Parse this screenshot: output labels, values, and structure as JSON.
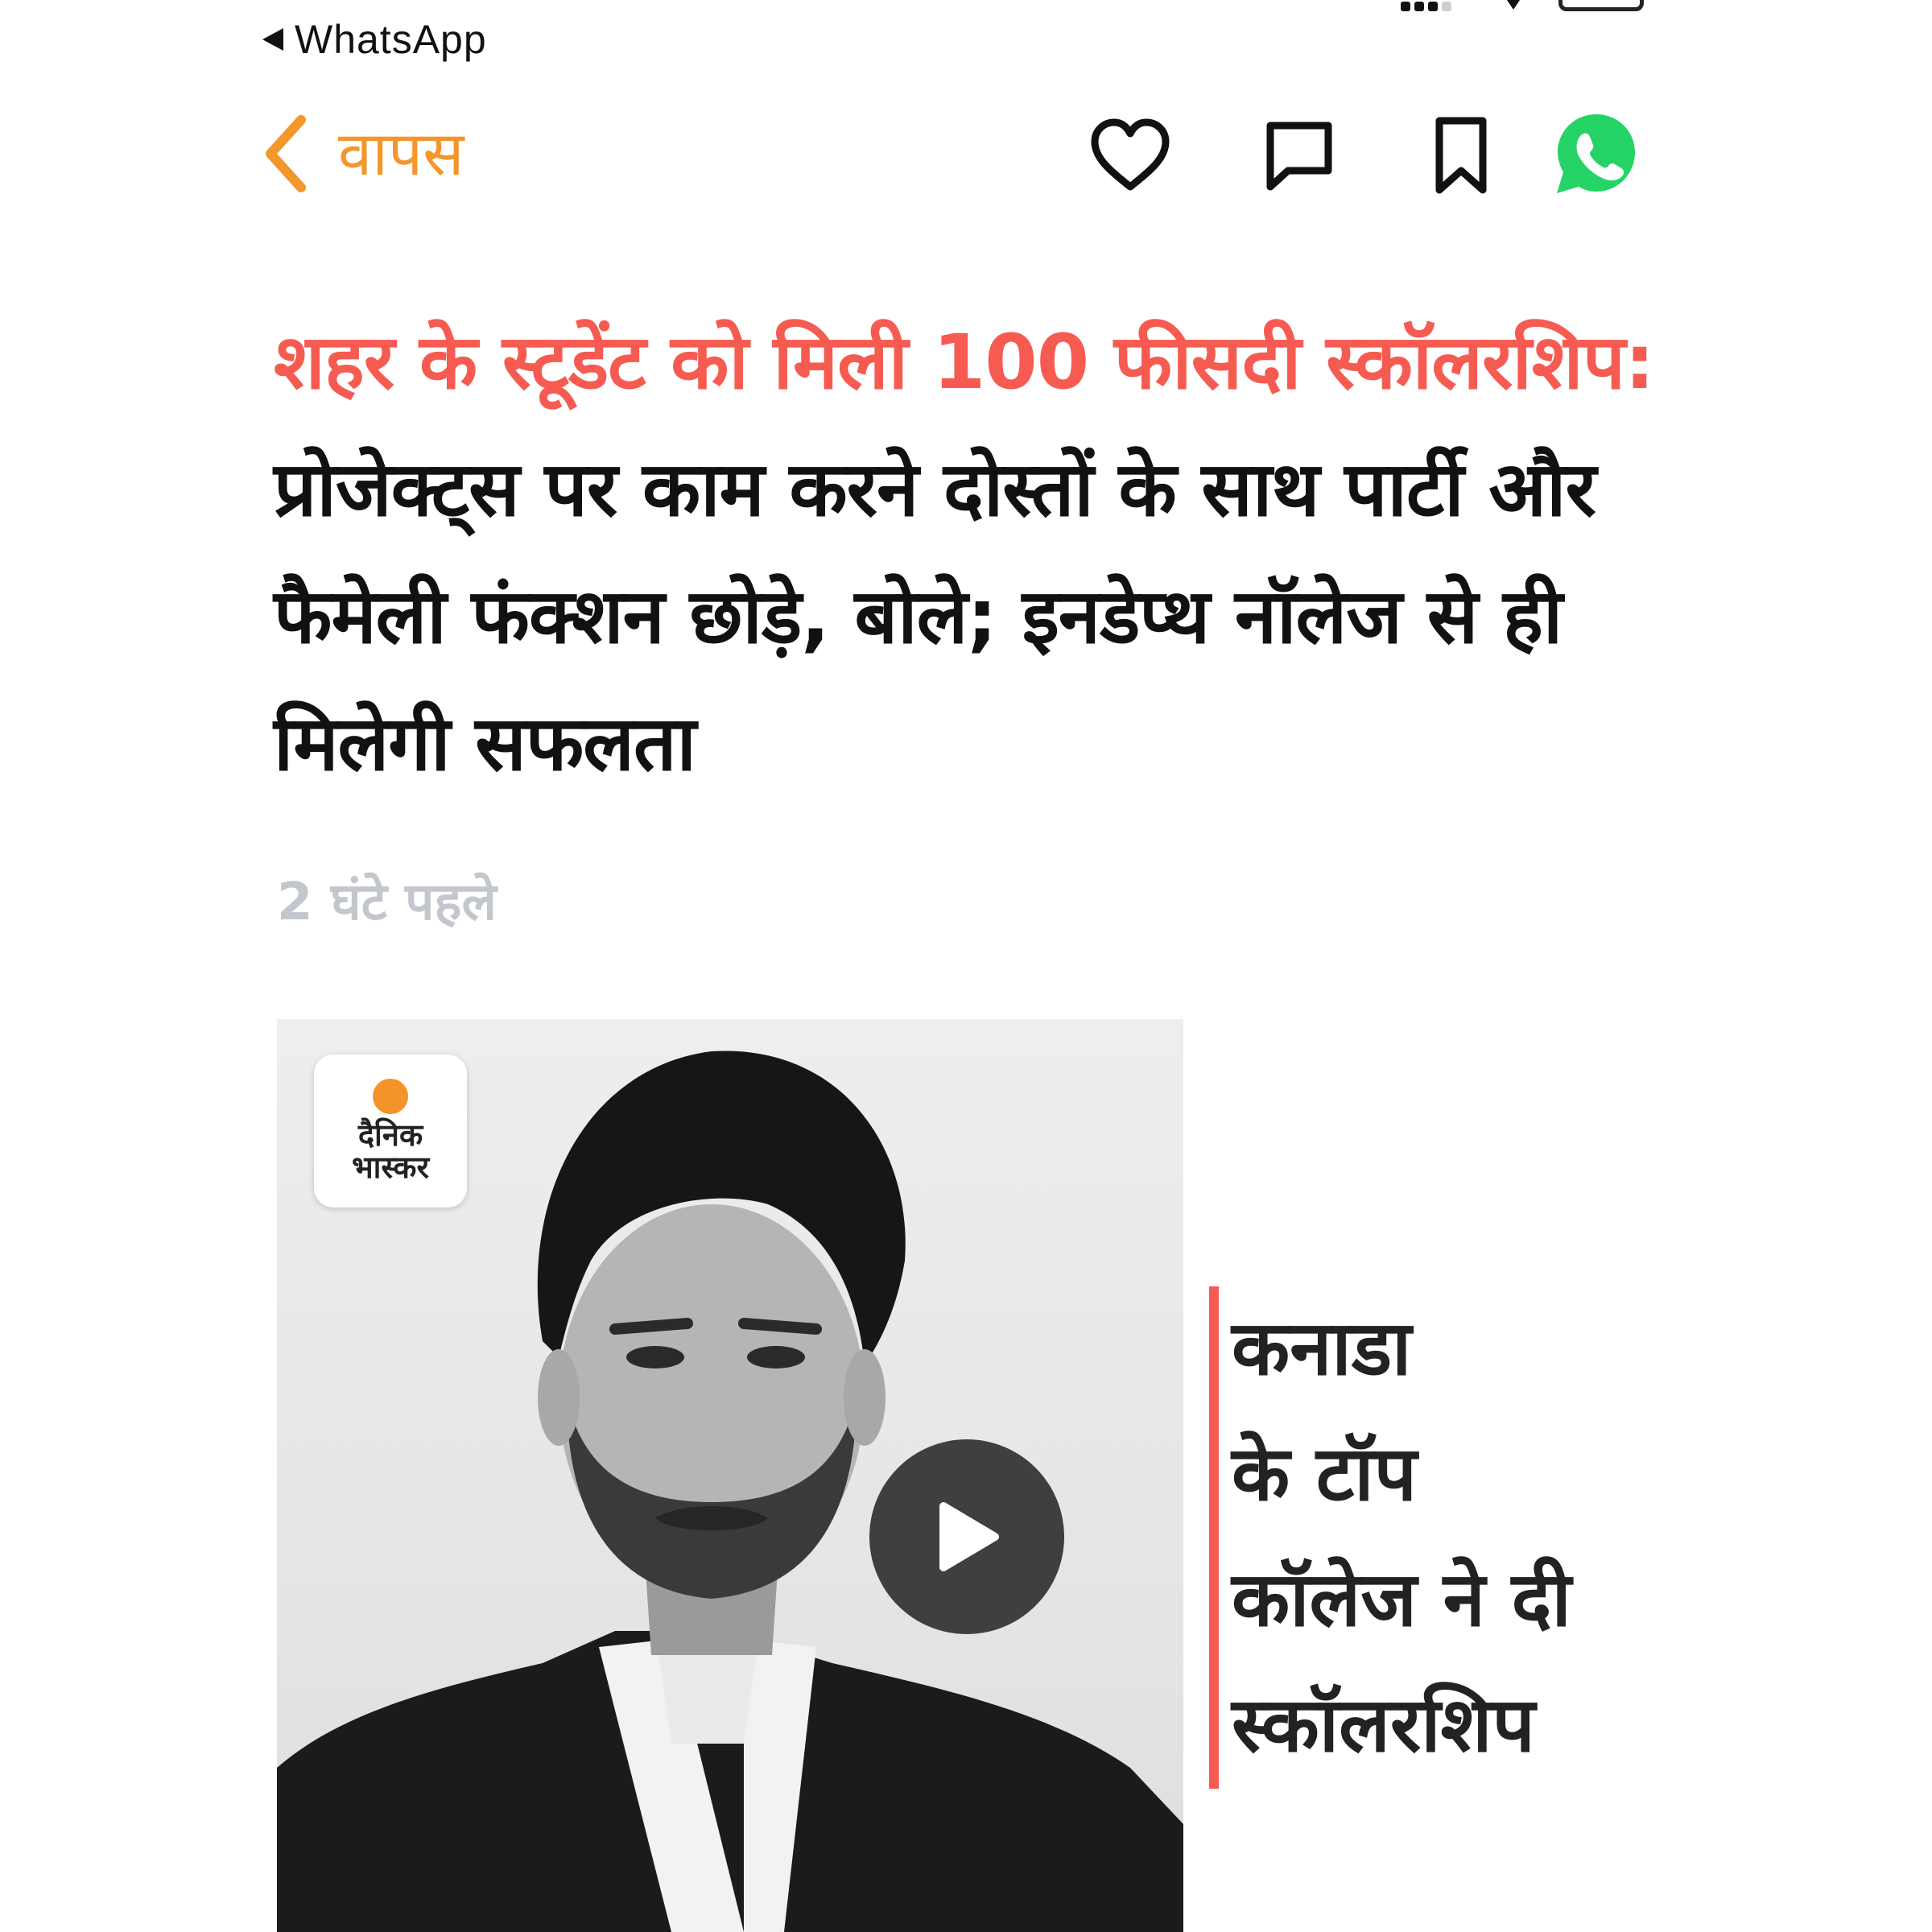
{
  "status_bar": {
    "back_app": "WhatsApp"
  },
  "nav": {
    "back_label": "वापस",
    "back_icon": "chevron-left-icon",
    "actions": [
      {
        "icon": "heart-icon"
      },
      {
        "icon": "comment-icon"
      },
      {
        "icon": "bookmark-icon"
      },
      {
        "icon": "whatsapp-icon"
      }
    ],
    "accent_color": "#f3962b",
    "whatsapp_color": "#25d366"
  },
  "article": {
    "kicker": "शहर के स्टूडेंट को मिली 100 फीसदी स्कॉलरशिप:",
    "title": "प्रोजेक्ट्स पर काम करने दोस्तों के साथ पार्टी और फैमेली फंक्शन छोड़े, बोले; इनडेप्थ नॉलेज से ही मिलेगी सफलता",
    "time_ago": "2 घंटे पहले",
    "kicker_color": "#f65b52"
  },
  "media": {
    "logo_text_line1": "दैनिक",
    "logo_text_line2": "भास्कर",
    "caption_lines": [
      "कनाडा",
      "के टॉप",
      "कॉलेज ने दी",
      "स्कॉलरशिप"
    ],
    "play_icon": "play-icon"
  }
}
